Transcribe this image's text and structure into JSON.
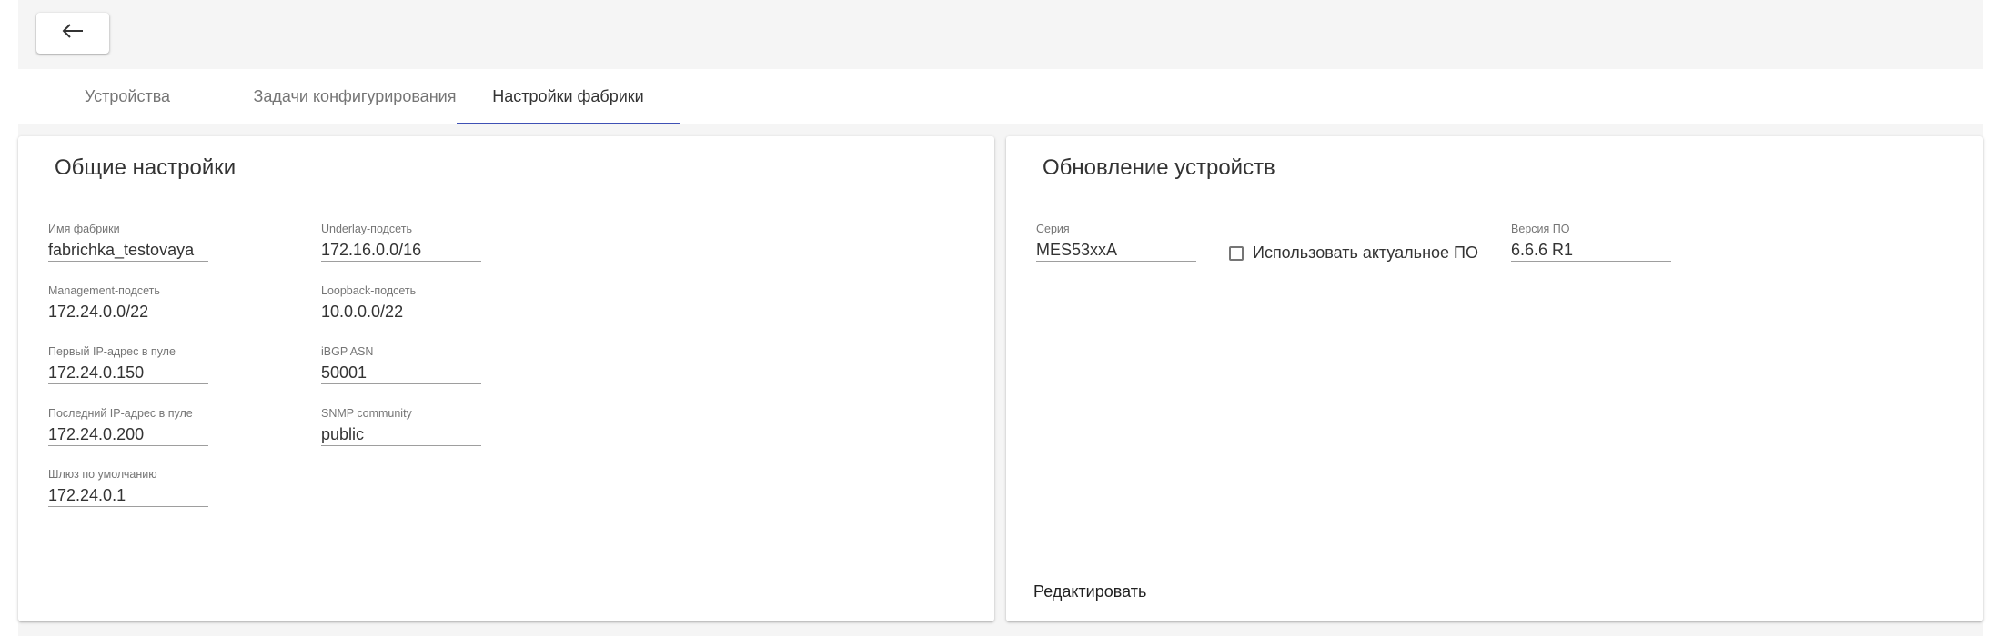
{
  "header": {
    "back_icon": "arrow-left-icon"
  },
  "tabs": [
    {
      "label": "Устройства",
      "active": false
    },
    {
      "label": "Задачи конфигурирования",
      "active": false
    },
    {
      "label": "Настройки фабрики",
      "active": true
    }
  ],
  "general": {
    "title": "Общие настройки",
    "fabric_name": {
      "label": "Имя фабрики",
      "value": "fabrichka_testovaya"
    },
    "underlay": {
      "label": "Underlay-подсеть",
      "value": "172.16.0.0/16"
    },
    "management": {
      "label": "Management-подсеть",
      "value": "172.24.0.0/22"
    },
    "loopback": {
      "label": "Loopback-подсеть",
      "value": "10.0.0.0/22"
    },
    "first_ip": {
      "label": "Первый IP-адрес в пуле",
      "value": "172.24.0.150"
    },
    "ibgp": {
      "label": "iBGP ASN",
      "value": "50001"
    },
    "last_ip": {
      "label": "Последний IP-адрес в пуле",
      "value": "172.24.0.200"
    },
    "snmp": {
      "label": "SNMP community",
      "value": "public"
    },
    "gateway": {
      "label": "Шлюз по умолчанию",
      "value": "172.24.0.1"
    }
  },
  "update": {
    "title": "Обновление устройств",
    "series": {
      "label": "Серия",
      "value": "MES53xxA"
    },
    "use_latest": {
      "label": "Использовать актуальное ПО",
      "checked": false
    },
    "version": {
      "label": "Версия ПО",
      "value": "6.6.6 R1"
    },
    "edit_label": "Редактировать"
  },
  "colors": {
    "accent": "#3f51b5",
    "background": "#f5f5f5",
    "card": "#ffffff"
  }
}
